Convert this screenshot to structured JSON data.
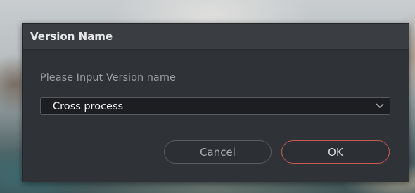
{
  "dialog": {
    "title": "Version Name",
    "prompt": "Please Input Version name",
    "input_value": "Cross process",
    "cancel_label": "Cancel",
    "ok_label": "OK"
  },
  "colors": {
    "dialog_bg": "#2f3236",
    "titlebar_bg": "#3a3d42",
    "input_bg": "#1c1e21",
    "ok_border": "#c85a55"
  },
  "icons": {
    "dropdown": "chevron-down-icon"
  }
}
